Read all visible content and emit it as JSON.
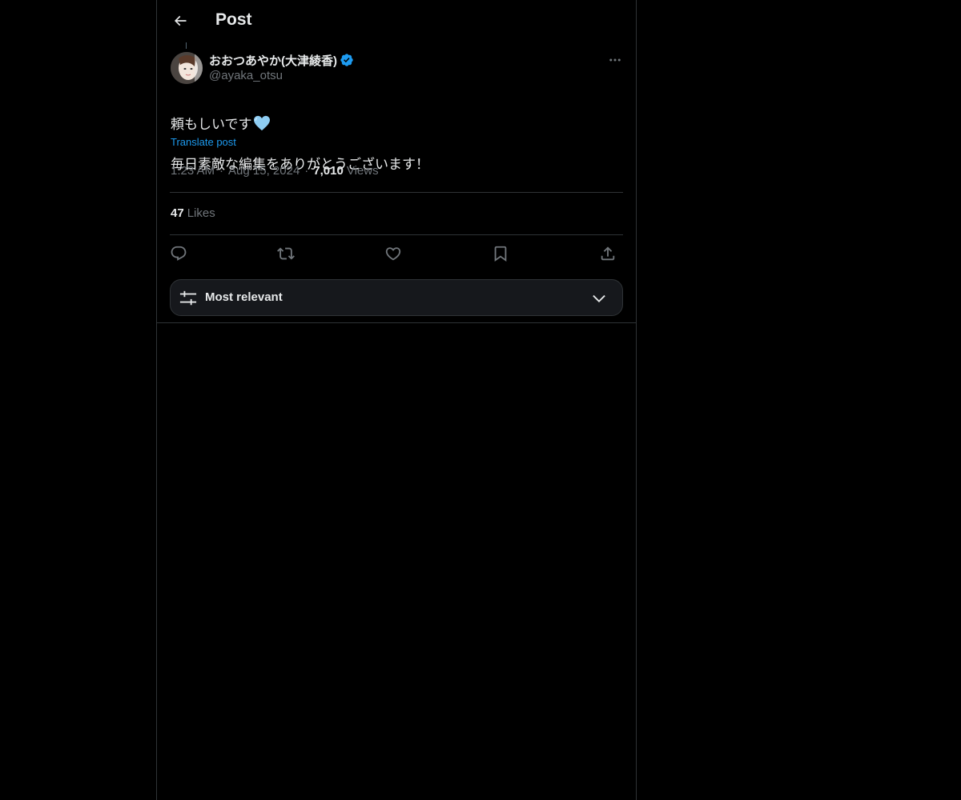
{
  "header": {
    "back_icon": "arrow-left-icon",
    "title": "Post"
  },
  "post": {
    "author": {
      "display_name": "おおつあやか(大津綾香)",
      "verified": true,
      "verified_color": "#1d9bf0",
      "handle": "@ayaka_otsu"
    },
    "text_line_1": "頼もしいです",
    "text_line_1_emoji": "light-blue-heart",
    "text_line_2": "毎日素敵な編集をありがとうございます！",
    "translate_label": "Translate post",
    "time": "1:23 AM",
    "separator": "·",
    "date": "Aug 15, 2024",
    "views_count": "7,010",
    "views_label": "Views",
    "likes_count": "47",
    "likes_label": "Likes"
  },
  "actions": [
    "reply-icon",
    "repost-icon",
    "like-icon",
    "bookmark-icon",
    "share-icon"
  ],
  "sort": {
    "label": "Most relevant",
    "icon": "sliders-icon",
    "chevron": "chevron-down-icon"
  },
  "colors": {
    "background": "#000000",
    "text": "#e7e9ea",
    "secondary_text": "#71767b",
    "accent": "#1d9bf0",
    "border": "#2f3336"
  }
}
